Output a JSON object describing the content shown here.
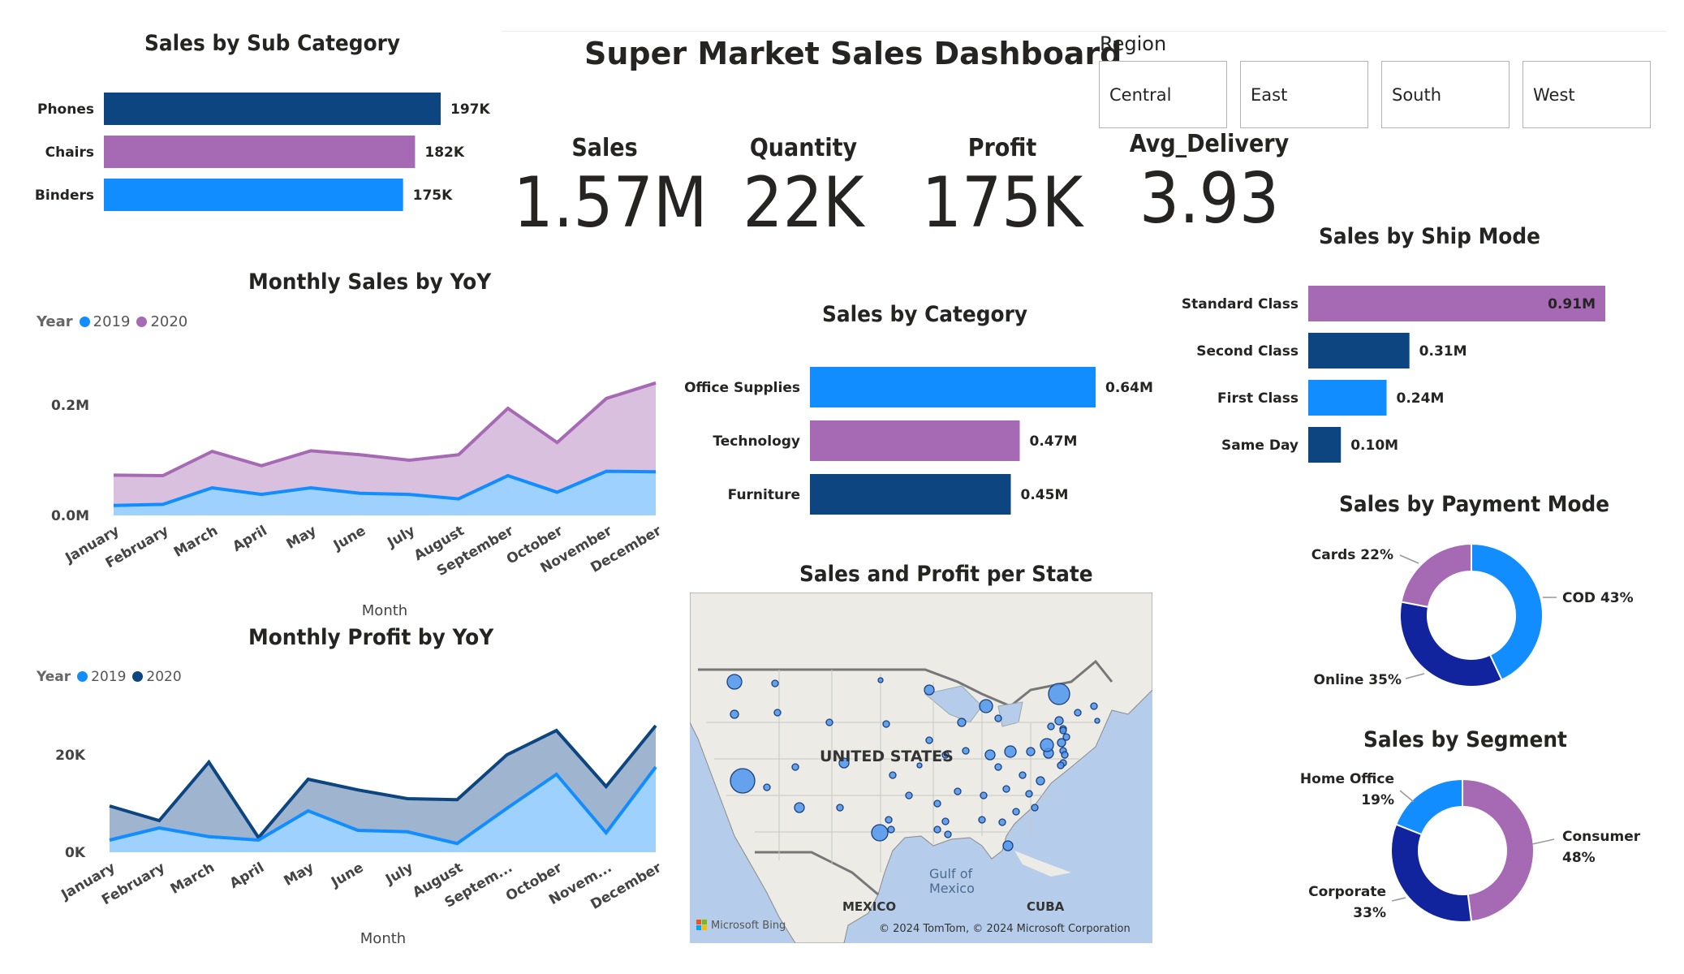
{
  "dashboard_title": "Super Market Sales Dashboard",
  "slicer": {
    "title": "Region",
    "options": [
      "Central",
      "East",
      "South",
      "West"
    ]
  },
  "cards": [
    {
      "label": "Sales",
      "value": "1.57M"
    },
    {
      "label": "Quantity",
      "value": "22K"
    },
    {
      "label": "Profit",
      "value": "175K"
    },
    {
      "label": "Avg_Delivery",
      "value": "3.93"
    }
  ],
  "colors": {
    "light_blue": "#118dff",
    "purple": "#a66ab4",
    "navy": "#0c4580",
    "dark_blue": "#12239e"
  },
  "map": {
    "title": "Sales and Profit per State",
    "country_label": "UNITED STATES",
    "gulf_label": "Gulf of\nMexico",
    "mexico_label": "MEXICO",
    "cuba_label": "CUBA",
    "attribution": "© 2024 TomTom, © 2024 Microsoft Corporation",
    "brand": "Microsoft Bing"
  },
  "chart_data": [
    {
      "id": "sub_category",
      "type": "bar",
      "orientation": "horizontal",
      "title": "Sales by Sub Category",
      "categories": [
        "Phones",
        "Chairs",
        "Binders"
      ],
      "values": [
        197,
        182,
        175
      ],
      "value_labels": [
        "197K",
        "182K",
        "175K"
      ],
      "colors": [
        "#0c4580",
        "#a66ab4",
        "#118dff"
      ]
    },
    {
      "id": "category",
      "type": "bar",
      "orientation": "horizontal",
      "title": "Sales by Category",
      "categories": [
        "Office Supplies",
        "Technology",
        "Furniture"
      ],
      "values": [
        0.64,
        0.47,
        0.45
      ],
      "value_labels": [
        "0.64M",
        "0.47M",
        "0.45M"
      ],
      "colors": [
        "#118dff",
        "#a66ab4",
        "#0c4580"
      ]
    },
    {
      "id": "ship_mode",
      "type": "bar",
      "orientation": "horizontal",
      "title": "Sales by Ship Mode",
      "categories": [
        "Standard Class",
        "Second Class",
        "First Class",
        "Same Day"
      ],
      "values": [
        0.91,
        0.31,
        0.24,
        0.1
      ],
      "value_labels": [
        "0.91M",
        "0.31M",
        "0.24M",
        "0.10M"
      ],
      "colors": [
        "#a66ab4",
        "#0c4580",
        "#118dff",
        "#0c4580"
      ]
    },
    {
      "id": "monthly_sales",
      "type": "area",
      "stacked": true,
      "title": "Monthly Sales by YoY",
      "xlabel": "Month",
      "legend_title": "Year",
      "categories": [
        "January",
        "February",
        "March",
        "April",
        "May",
        "June",
        "July",
        "August",
        "September",
        "October",
        "November",
        "December"
      ],
      "series": [
        {
          "name": "2019",
          "color": "#118dff",
          "values": [
            0.018,
            0.02,
            0.05,
            0.038,
            0.05,
            0.04,
            0.038,
            0.03,
            0.072,
            0.042,
            0.08,
            0.079
          ]
        },
        {
          "name": "2020",
          "color": "#a66ab4",
          "values": [
            0.055,
            0.052,
            0.066,
            0.052,
            0.067,
            0.07,
            0.062,
            0.08,
            0.122,
            0.09,
            0.132,
            0.161
          ]
        }
      ],
      "yticks": [
        "0.0M",
        "0.2M"
      ],
      "ylim": [
        0,
        0.25
      ]
    },
    {
      "id": "monthly_profit",
      "type": "area",
      "stacked": false,
      "title": "Monthly Profit by YoY",
      "xlabel": "Month",
      "legend_title": "Year",
      "categories": [
        "January",
        "February",
        "March",
        "April",
        "May",
        "June",
        "July",
        "August",
        "Septem...",
        "October",
        "Novem...",
        "December"
      ],
      "series": [
        {
          "name": "2019",
          "color": "#118dff",
          "values": [
            2500,
            5000,
            3200,
            2500,
            8500,
            4500,
            4200,
            1800,
            9000,
            16000,
            4000,
            17500
          ]
        },
        {
          "name": "2020",
          "color": "#0c4580",
          "values": [
            9500,
            6500,
            18500,
            3000,
            15000,
            12800,
            11000,
            10800,
            20000,
            25000,
            13500,
            26000
          ]
        }
      ],
      "yticks": [
        "0K",
        "20K"
      ],
      "ylim": [
        0,
        30000
      ]
    },
    {
      "id": "payment_mode",
      "type": "pie",
      "donut": true,
      "title": "Sales by Payment Mode",
      "labels": [
        "COD 43%",
        "Online 35%",
        "Cards 22%"
      ],
      "values": [
        43,
        35,
        22
      ],
      "colors": [
        "#118dff",
        "#12239e",
        "#a66ab4"
      ]
    },
    {
      "id": "segment",
      "type": "pie",
      "donut": true,
      "title": "Sales by Segment",
      "labels": [
        "Consumer 48%",
        "Corporate 33%",
        "Home Office 19%"
      ],
      "values": [
        48,
        33,
        19
      ],
      "colors": [
        "#a66ab4",
        "#12239e",
        "#118dff"
      ]
    }
  ]
}
